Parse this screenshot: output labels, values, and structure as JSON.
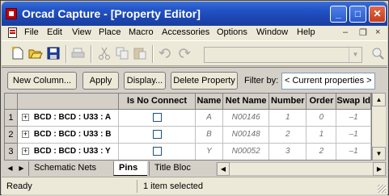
{
  "window": {
    "title": "Orcad Capture - [Property Editor]",
    "min_icon": "minimize-icon",
    "max_icon": "maximize-icon",
    "close_icon": "close-icon"
  },
  "menu": {
    "items": [
      "File",
      "Edit",
      "View",
      "Place",
      "Macro",
      "Accessories",
      "Options",
      "Window",
      "Help"
    ],
    "mdi_min": "–",
    "mdi_restore": "❐",
    "mdi_close": "×"
  },
  "toolbar": {
    "icons": [
      "new-icon",
      "open-icon",
      "save-icon",
      "print-icon",
      "cut-icon",
      "copy-icon",
      "paste-icon",
      "undo-icon",
      "redo-icon",
      "zoom-icon"
    ],
    "combo_value": ""
  },
  "editor": {
    "buttons": {
      "new_column": "New Column...",
      "apply": "Apply",
      "display": "Display...",
      "delete_property": "Delete Property"
    },
    "filter_label": "Filter by:",
    "filter_value": "< Current properties >"
  },
  "grid": {
    "columns": [
      "",
      "",
      "Is No Connect",
      "Name",
      "Net Name",
      "Number",
      "Order",
      "Swap Id"
    ],
    "rows": [
      {
        "num": "1",
        "part": "BCD : BCD : U33 : A",
        "no_connect": false,
        "name": "A",
        "net": "N00146",
        "number": "1",
        "order": "0",
        "swap": "–1"
      },
      {
        "num": "2",
        "part": "BCD : BCD : U33 : B",
        "no_connect": false,
        "name": "B",
        "net": "N00148",
        "number": "2",
        "order": "1",
        "swap": "–1"
      },
      {
        "num": "3",
        "part": "BCD : BCD : U33 : Y",
        "no_connect": false,
        "name": "Y",
        "net": "N00052",
        "number": "3",
        "order": "2",
        "swap": "–1"
      }
    ]
  },
  "tabs": {
    "items": [
      "Schematic Nets",
      "Pins",
      "Title Bloc"
    ],
    "active": "Pins"
  },
  "status": {
    "left": "Ready",
    "right": "1 item selected"
  }
}
